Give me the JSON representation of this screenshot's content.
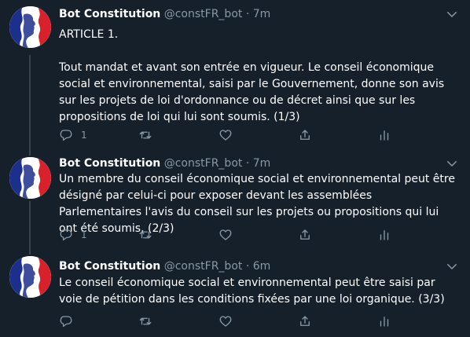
{
  "colors": {
    "background": "#15202b",
    "text_primary": "#ffffff",
    "text_secondary": "#8899a6",
    "thread_line": "#38444d",
    "avatar_blue": "#1c2f8c",
    "avatar_red": "#d8212a"
  },
  "tweets": [
    {
      "display_name": "Bot Constitution",
      "handle": "@constFR_bot",
      "separator": "·",
      "time": "7m",
      "text": "ARTICLE 1.\n\nTout mandat et avant son entrée en vigueur. Le conseil économique social et environnemental, saisi par le Gouvernement, donne son avis sur les projets de loi d'ordonnance ou de décret ainsi que sur les propositions de loi qui lui sont soumis. (1/3)",
      "reply_count": "1",
      "icons": [
        "avatar-flag-profile",
        "chevron-down-icon",
        "reply-icon",
        "retweet-icon",
        "like-icon",
        "share-icon",
        "analytics-icon"
      ]
    },
    {
      "display_name": "Bot Constitution",
      "handle": "@constFR_bot",
      "separator": "·",
      "time": "7m",
      "text": "Un membre du conseil économique social et environnemental peut être désigné par celui-ci pour exposer devant les assemblées Parlementaires l'avis du conseil sur les projets ou propositions qui lui ont été soumis. (2/3)",
      "reply_count": "1"
    },
    {
      "display_name": "Bot Constitution",
      "handle": "@constFR_bot",
      "separator": "·",
      "time": "6m",
      "text": "Le conseil économique social et environnemental peut être saisi par voie de pétition dans les conditions fixées par une loi organique. (3/3)",
      "reply_count": ""
    }
  ]
}
